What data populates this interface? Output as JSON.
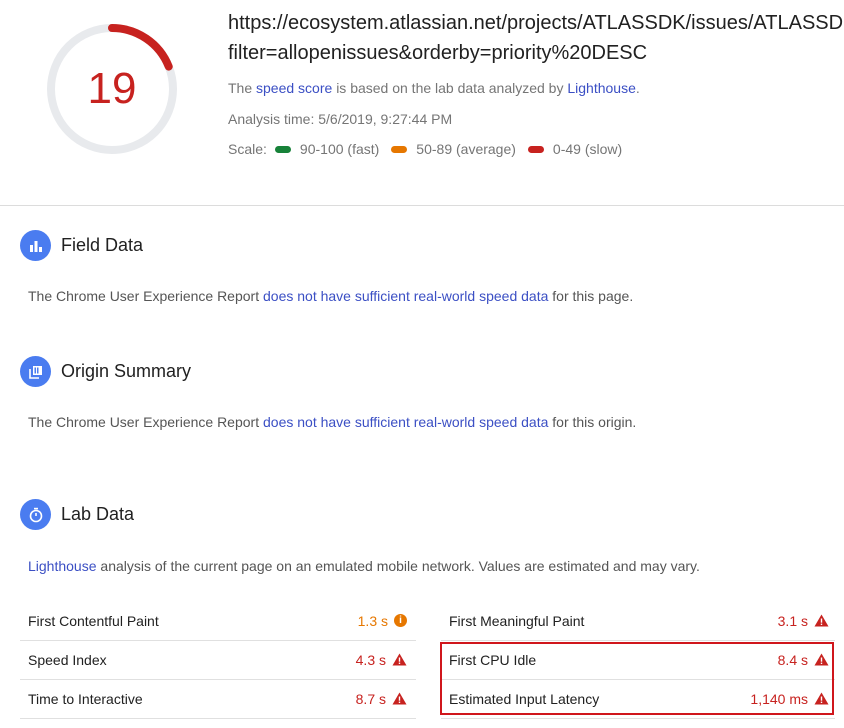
{
  "score": {
    "value": "19",
    "fraction": 0.19,
    "color": "#c7221f"
  },
  "header": {
    "url_line1": "https://ecosystem.atlassian.net/projects/ATLASSDK/issues/ATLASSDK",
    "url_line2": "filter=allopenissues&orderby=priority%20DESC",
    "desc_pre": "The",
    "desc_link1": "speed score",
    "desc_mid": "is based on the lab data analyzed by",
    "desc_link2": "Lighthouse",
    "desc_end": ".",
    "analysis_time": "Analysis time: 5/6/2019, 9:27:44 PM",
    "scale_label": "Scale:",
    "scale": [
      {
        "label": "90-100 (fast)",
        "color": "#178239"
      },
      {
        "label": "50-89 (average)",
        "color": "#e67700"
      },
      {
        "label": "0-49 (slow)",
        "color": "#c7221f"
      }
    ]
  },
  "field_data": {
    "title": "Field Data",
    "icon": "bar-chart-icon",
    "text_pre": "The Chrome User Experience Report",
    "text_link": "does not have sufficient real-world speed data",
    "text_post": "for this page."
  },
  "origin_summary": {
    "title": "Origin Summary",
    "icon": "library-icon",
    "text_pre": "The Chrome User Experience Report",
    "text_link": "does not have sufficient real-world speed data",
    "text_post": "for this origin."
  },
  "lab_data": {
    "title": "Lab Data",
    "icon": "stopwatch-icon",
    "text_link": "Lighthouse",
    "text_post": "analysis of the current page on an emulated mobile network. Values are estimated and may vary."
  },
  "metrics_left": [
    {
      "label": "First Contentful Paint",
      "value": "1.3 s",
      "status": "average"
    },
    {
      "label": "Speed Index",
      "value": "4.3 s",
      "status": "slow"
    },
    {
      "label": "Time to Interactive",
      "value": "8.7 s",
      "status": "slow"
    }
  ],
  "metrics_right": [
    {
      "label": "First Meaningful Paint",
      "value": "3.1 s",
      "status": "slow"
    },
    {
      "label": "First CPU Idle",
      "value": "8.4 s",
      "status": "slow"
    },
    {
      "label": "Estimated Input Latency",
      "value": "1,140 ms",
      "status": "slow"
    }
  ],
  "colors": {
    "accent_blue": "#4a7cf0",
    "link": "#3b4fc4",
    "slow": "#c7221f",
    "average": "#e67700",
    "fast": "#178239"
  }
}
